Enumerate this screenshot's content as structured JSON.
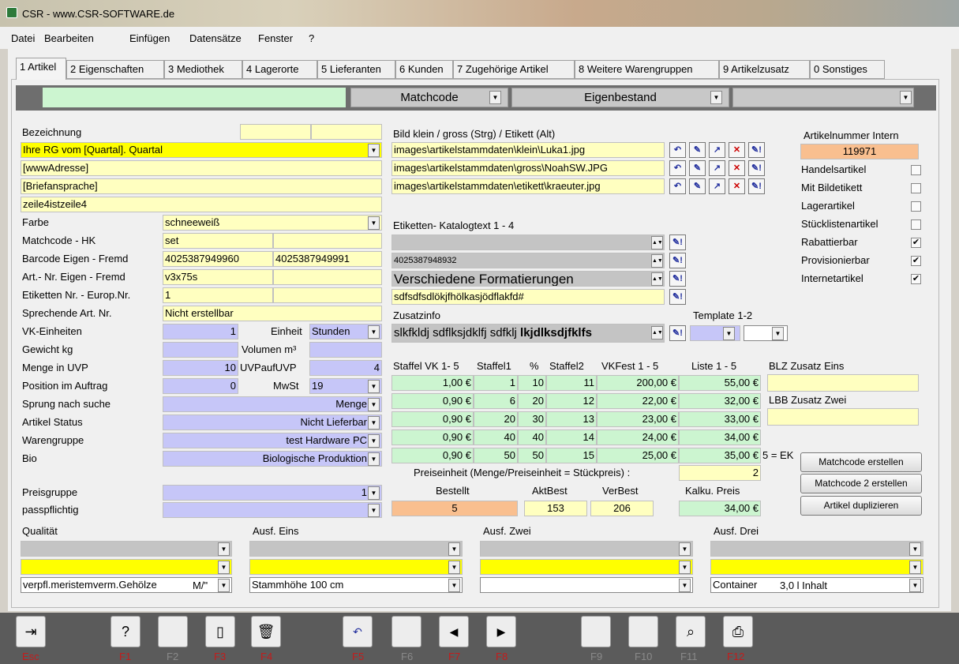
{
  "window": {
    "title": "CSR -  www.CSR-SOFTWARE.de"
  },
  "menu": [
    "Datei",
    "Bearbeiten",
    "Einfügen",
    "Datensätze",
    "Fenster",
    "?"
  ],
  "tabs": [
    "1 Artikel",
    "2 Eigenschaften",
    "3 Mediothek",
    "4 Lagerorte",
    "5 Lieferanten",
    "6 Kunden",
    "7 Zugehörige Artikel",
    "8 Weitere Warengruppen",
    "9 Artikelzusatz",
    "0 Sonstiges"
  ],
  "filter": {
    "search": "",
    "matchcode": "Matchcode",
    "bestand": "Eigenbestand",
    "extra": ""
  },
  "left": {
    "bezeichnung_label": "Bezeichnung",
    "bez1": "Ihre RG vom [Quartal]. Quartal",
    "bez2": "[wwwAdresse]",
    "bez3": "[Briefansprache]",
    "bez4": "zeile4istzeile4",
    "rows": [
      {
        "label": "Farbe",
        "v1": "schneeweiß"
      },
      {
        "label": "Matchcode - HK",
        "v1": "set",
        "v2": ""
      },
      {
        "label": "Barcode Eigen - Fremd",
        "v1": "4025387949960",
        "v2": "4025387949991"
      },
      {
        "label": "Art.- Nr. Eigen - Fremd",
        "v1": "v3x75s",
        "v2": ""
      },
      {
        "label": "Etiketten Nr. -  Europ.Nr.",
        "v1": "1",
        "v2": ""
      },
      {
        "label": "Sprechende Art. Nr.",
        "v1": "Nicht erstellbar"
      }
    ],
    "vk_label": "VK-Einheiten",
    "vk": "1",
    "einheit_label": "Einheit",
    "einheit": "Stunden",
    "gewicht_label": "Gewicht kg",
    "gewicht": "",
    "volumen_label": "Volumen m³",
    "volumen": "",
    "menge_label": "Menge in UVP",
    "menge": "10",
    "uvp_label": "UVPaufUVP",
    "uvp": "4",
    "position_label": "Position im Auftrag",
    "position": "0",
    "mwst_label": "MwSt",
    "mwst": "19",
    "sprung_label": "Sprung nach suche",
    "sprung": "Menge",
    "status_label": "Artikel Status",
    "status": "Nicht Lieferbar",
    "warengruppe_label": "Warengruppe",
    "warengruppe": "test Hardware PC",
    "bio_label": "Bio",
    "bio": "Biologische Produktion",
    "preisgruppe_label": "Preisgruppe",
    "preisgruppe": "1",
    "pass_label": "passpflichtig",
    "pass": ""
  },
  "images": {
    "label": "Bild klein / gross (Strg) / Etikett (Alt)",
    "paths": [
      "images\\artikelstammdaten\\klein\\Luka1.jpg",
      "images\\artikelstammdaten\\gross\\NoahSW.JPG",
      "images\\artikelstammdaten\\etikett\\kraeuter.jpg"
    ]
  },
  "etikett": {
    "label": "Etiketten- Katalogtext 1 - 4",
    "t1": "",
    "t2": "4025387948932",
    "t3": "Verschiedene Formatierungen",
    "t4": "sdfsdfsdlökjfhölkasjödflakfd#"
  },
  "zusatz": {
    "label": "Zusatzinfo",
    "text_plain": "slkfkldj sdflksjdklfj sdfklj ",
    "text_bold": "lkjdlksdjfklfs",
    "template_label": "Template 1-2"
  },
  "right": {
    "artnr_label": "Artikelnummer Intern",
    "artnr": "119971",
    "flags": [
      {
        "label": "Handelsartikel",
        "checked": false
      },
      {
        "label": "Mit Bildetikett",
        "checked": false
      },
      {
        "label": "Lagerartikel",
        "checked": false
      },
      {
        "label": "Stücklistenartikel",
        "checked": false
      },
      {
        "label": "Rabattierbar",
        "checked": true
      },
      {
        "label": "Provisionierbar",
        "checked": true
      },
      {
        "label": "Internetartikel",
        "checked": true
      }
    ],
    "blz_label": "BLZ Zusatz Eins",
    "lbb_label": "LBB Zusatz Zwei"
  },
  "staffel": {
    "headers": [
      "Staffel VK 1- 5",
      "Staffel1",
      "%",
      "Staffel2",
      "VKFest 1 - 5",
      "Liste 1 - 5"
    ],
    "rows": [
      [
        "1,00 €",
        "1",
        "10",
        "11",
        "200,00 €",
        "55,00 €"
      ],
      [
        "0,90 €",
        "6",
        "20",
        "12",
        "22,00 €",
        "32,00 €"
      ],
      [
        "0,90 €",
        "20",
        "30",
        "13",
        "23,00 €",
        "33,00 €"
      ],
      [
        "0,90 €",
        "40",
        "40",
        "14",
        "24,00 €",
        "34,00 €"
      ],
      [
        "0,90 €",
        "50",
        "50",
        "15",
        "25,00 €",
        "35,00 €"
      ]
    ],
    "ek_note": "5 = EK",
    "preiseinheit_label": "Preiseinheit (Menge/Preiseinheit = Stückpreis) :",
    "preiseinheit": "2"
  },
  "bestand": {
    "bestellt_label": "Bestellt",
    "bestellt": "5",
    "akt_label": "AktBest",
    "akt": "153",
    "ver_label": "VerBest",
    "ver": "206",
    "kalku_label": "Kalku. Preis",
    "kalku": "34,00 €"
  },
  "buttons": {
    "mc1": "Matchcode erstellen",
    "mc2": "Matchcode 2 erstellen",
    "dup": "Artikel duplizieren"
  },
  "quality": {
    "q_label": "Qualität",
    "q3": "verpfl.meristemverm.Gehölze",
    "q3b": "M/\"",
    "e_label": "Ausf. Eins",
    "e3": "Stammhöhe 100 cm",
    "z_label": "Ausf. Zwei",
    "d_label": "Ausf. Drei",
    "d3a": "Container",
    "d3b": "3,0 l Inhalt"
  },
  "toolbar": [
    "Esc",
    "F1",
    "F2",
    "F3",
    "F4",
    "F5",
    "F6",
    "F7",
    "F8",
    "F9",
    "F10",
    "F11",
    "F12"
  ],
  "colors": {
    "yellow": "#ffffc0",
    "bright_yellow": "#ffff00",
    "blue": "#c6c6f8",
    "green": "#ccf5d0",
    "orange": "#f9bf8f",
    "gray": "#c4c4c4"
  }
}
